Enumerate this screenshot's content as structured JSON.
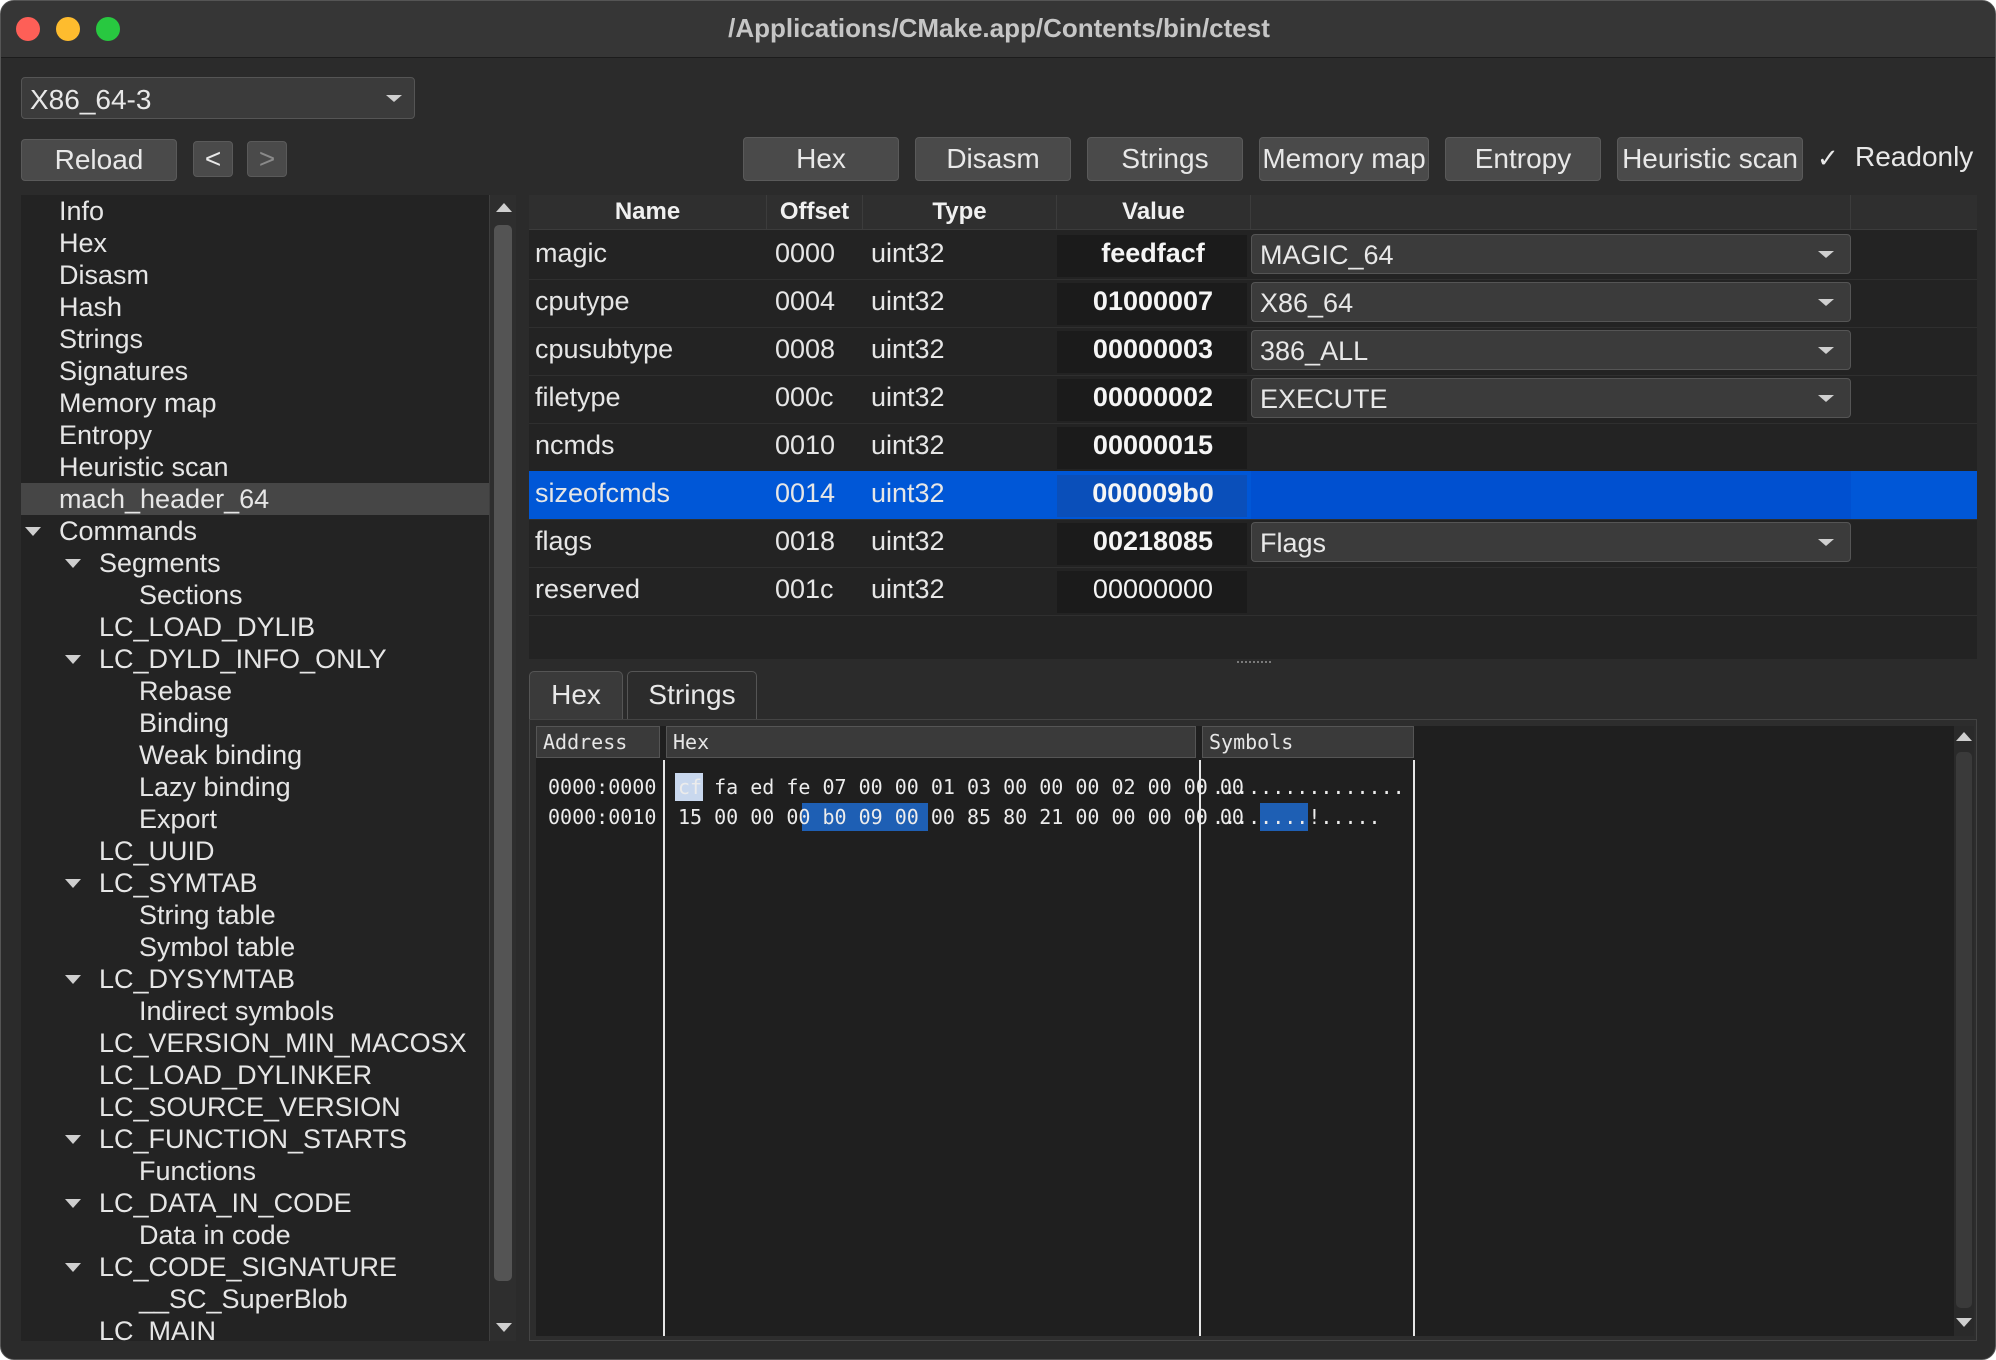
{
  "window": {
    "title": "/Applications/CMake.app/Contents/bin/ctest"
  },
  "arch_select": {
    "value": "X86_64-3"
  },
  "toolbar": {
    "reload": "Reload",
    "back": "<",
    "forward": ">",
    "hex": "Hex",
    "disasm": "Disasm",
    "strings": "Strings",
    "memory_map": "Memory map",
    "entropy": "Entropy",
    "heuristic_scan": "Heuristic scan",
    "readonly_label": "Readonly",
    "readonly_checked": true,
    "check_glyph": "✓"
  },
  "tree": [
    {
      "label": "Info",
      "level": 1,
      "expander": false,
      "selected": false
    },
    {
      "label": "Hex",
      "level": 1,
      "expander": false,
      "selected": false
    },
    {
      "label": "Disasm",
      "level": 1,
      "expander": false,
      "selected": false
    },
    {
      "label": "Hash",
      "level": 1,
      "expander": false,
      "selected": false
    },
    {
      "label": "Strings",
      "level": 1,
      "expander": false,
      "selected": false
    },
    {
      "label": "Signatures",
      "level": 1,
      "expander": false,
      "selected": false
    },
    {
      "label": "Memory map",
      "level": 1,
      "expander": false,
      "selected": false
    },
    {
      "label": "Entropy",
      "level": 1,
      "expander": false,
      "selected": false
    },
    {
      "label": "Heuristic scan",
      "level": 1,
      "expander": false,
      "selected": false
    },
    {
      "label": "mach_header_64",
      "level": 1,
      "expander": false,
      "selected": true
    },
    {
      "label": "Commands",
      "level": 1,
      "expander": true,
      "selected": false
    },
    {
      "label": "Segments",
      "level": 2,
      "expander": true,
      "selected": false
    },
    {
      "label": "Sections",
      "level": 3,
      "expander": false,
      "selected": false
    },
    {
      "label": "LC_LOAD_DYLIB",
      "level": 2,
      "expander": false,
      "selected": false
    },
    {
      "label": "LC_DYLD_INFO_ONLY",
      "level": 2,
      "expander": true,
      "selected": false
    },
    {
      "label": "Rebase",
      "level": 3,
      "expander": false,
      "selected": false
    },
    {
      "label": "Binding",
      "level": 3,
      "expander": false,
      "selected": false
    },
    {
      "label": "Weak binding",
      "level": 3,
      "expander": false,
      "selected": false
    },
    {
      "label": "Lazy binding",
      "level": 3,
      "expander": false,
      "selected": false
    },
    {
      "label": "Export",
      "level": 3,
      "expander": false,
      "selected": false
    },
    {
      "label": "LC_UUID",
      "level": 2,
      "expander": false,
      "selected": false
    },
    {
      "label": "LC_SYMTAB",
      "level": 2,
      "expander": true,
      "selected": false
    },
    {
      "label": "String table",
      "level": 3,
      "expander": false,
      "selected": false
    },
    {
      "label": "Symbol table",
      "level": 3,
      "expander": false,
      "selected": false
    },
    {
      "label": "LC_DYSYMTAB",
      "level": 2,
      "expander": true,
      "selected": false
    },
    {
      "label": "Indirect symbols",
      "level": 3,
      "expander": false,
      "selected": false
    },
    {
      "label": "LC_VERSION_MIN_MACOSX",
      "level": 2,
      "expander": false,
      "selected": false
    },
    {
      "label": "LC_LOAD_DYLINKER",
      "level": 2,
      "expander": false,
      "selected": false
    },
    {
      "label": "LC_SOURCE_VERSION",
      "level": 2,
      "expander": false,
      "selected": false
    },
    {
      "label": "LC_FUNCTION_STARTS",
      "level": 2,
      "expander": true,
      "selected": false
    },
    {
      "label": "Functions",
      "level": 3,
      "expander": false,
      "selected": false
    },
    {
      "label": "LC_DATA_IN_CODE",
      "level": 2,
      "expander": true,
      "selected": false
    },
    {
      "label": "Data in code",
      "level": 3,
      "expander": false,
      "selected": false
    },
    {
      "label": "LC_CODE_SIGNATURE",
      "level": 2,
      "expander": true,
      "selected": false
    },
    {
      "label": "__SC_SuperBlob",
      "level": 3,
      "expander": false,
      "selected": false
    },
    {
      "label": "LC_MAIN",
      "level": 2,
      "expander": false,
      "selected": false
    }
  ],
  "header_table": {
    "columns": [
      "Name",
      "Offset",
      "Type",
      "Value"
    ],
    "rows": [
      {
        "name": "magic",
        "offset": "0000",
        "type": "uint32",
        "value": "feedfacf",
        "bold": true,
        "combo": "MAGIC_64",
        "selected": false
      },
      {
        "name": "cputype",
        "offset": "0004",
        "type": "uint32",
        "value": "01000007",
        "bold": true,
        "combo": "X86_64",
        "selected": false
      },
      {
        "name": "cpusubtype",
        "offset": "0008",
        "type": "uint32",
        "value": "00000003",
        "bold": true,
        "combo": "386_ALL",
        "selected": false
      },
      {
        "name": "filetype",
        "offset": "000c",
        "type": "uint32",
        "value": "00000002",
        "bold": true,
        "combo": "EXECUTE",
        "selected": false
      },
      {
        "name": "ncmds",
        "offset": "0010",
        "type": "uint32",
        "value": "00000015",
        "bold": true,
        "combo": null,
        "selected": false
      },
      {
        "name": "sizeofcmds",
        "offset": "0014",
        "type": "uint32",
        "value": "000009b0",
        "bold": true,
        "combo": null,
        "selected": true
      },
      {
        "name": "flags",
        "offset": "0018",
        "type": "uint32",
        "value": "00218085",
        "bold": true,
        "combo": "Flags",
        "selected": false
      },
      {
        "name": "reserved",
        "offset": "001c",
        "type": "uint32",
        "value": "00000000",
        "bold": false,
        "combo": null,
        "selected": false
      }
    ]
  },
  "bottom_tabs": [
    {
      "label": "Hex",
      "active": true
    },
    {
      "label": "Strings",
      "active": false
    }
  ],
  "hex_view": {
    "headers": {
      "address": "Address",
      "hex": "Hex",
      "symbols": "Symbols"
    },
    "rows": [
      {
        "address": "0000:0000",
        "bytes": "cf fa ed fe 07 00 00 01 03 00 00 00 02 00 00 00",
        "symbols": "................"
      },
      {
        "address": "0000:0010",
        "bytes": "15 00 00 00 b0 09 00 00 85 80 21 00 00 00 00 00",
        "symbols": "........!....."
      }
    ],
    "cursor_byte": "cf",
    "selected_bytes": "b0 09 00 00"
  },
  "colors": {
    "selection": "#0057d7",
    "window_bg": "#2b2b2b"
  }
}
